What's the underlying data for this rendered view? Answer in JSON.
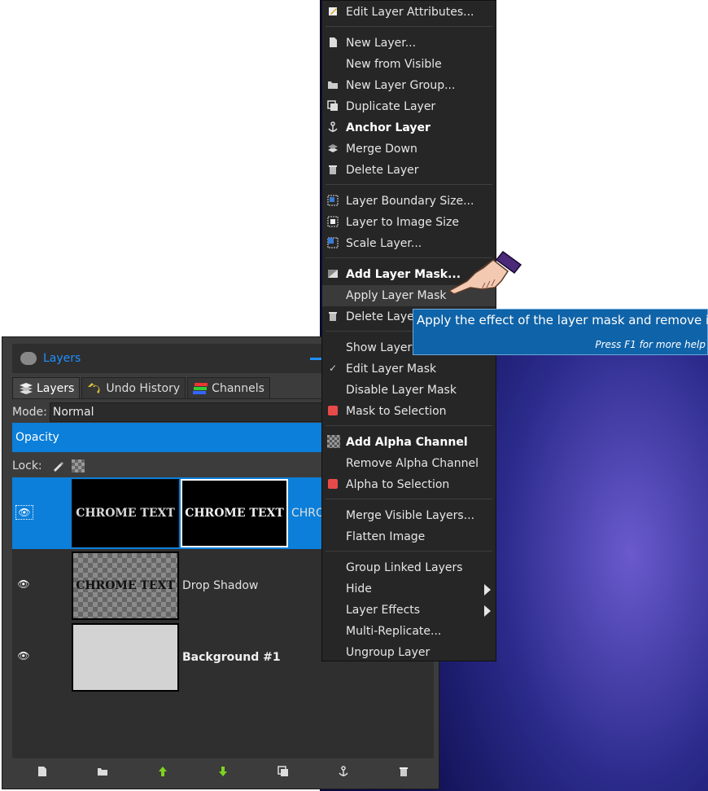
{
  "dock": {
    "title": "Layers",
    "tabs": [
      {
        "label": "Layers",
        "icon": "layers-icon"
      },
      {
        "label": "Undo History",
        "icon": "undo-history-icon"
      },
      {
        "label": "Channels",
        "icon": "channels-icon"
      }
    ],
    "mode_label": "Mode:",
    "mode_value": "Normal",
    "opacity_label": "Opacity",
    "lock_label": "Lock:",
    "layers": [
      {
        "thumb_text": "CHROME TEXT",
        "mask_text": "CHROME TEXT",
        "name": "CHRO",
        "selected": true
      },
      {
        "thumb_text": "CHROME TEXT",
        "name": "Drop Shadow"
      },
      {
        "name": "Background #1"
      }
    ]
  },
  "menu": {
    "items": [
      {
        "label": "Edit Layer Attributes...",
        "icon": "edit-icon"
      },
      {
        "label": "New Layer...",
        "icon": "new-layer-icon"
      },
      {
        "label": "New from Visible",
        "icon": ""
      },
      {
        "label": "New Layer Group...",
        "icon": "folder-icon"
      },
      {
        "label": "Duplicate Layer",
        "icon": "duplicate-icon"
      },
      {
        "label": "Anchor Layer",
        "icon": "anchor-icon",
        "bold": true
      },
      {
        "label": "Merge Down",
        "icon": "merge-down-icon"
      },
      {
        "label": "Delete Layer",
        "icon": "trash-icon"
      },
      {
        "label": "Layer Boundary Size...",
        "icon": "boundary-icon"
      },
      {
        "label": "Layer to Image Size",
        "icon": "to-image-icon"
      },
      {
        "label": "Scale Layer...",
        "icon": "scale-icon"
      },
      {
        "label": "Add Layer Mask...",
        "icon": "add-mask-icon",
        "bold": true
      },
      {
        "label": "Apply Layer Mask",
        "icon": "",
        "highlighted": true
      },
      {
        "label": "Delete Layer Mask",
        "icon": "trash-icon"
      },
      {
        "label": "Show Layer Mask",
        "icon": ""
      },
      {
        "label": "Edit Layer Mask",
        "icon": "check-icon"
      },
      {
        "label": "Disable Layer Mask",
        "icon": ""
      },
      {
        "label": "Mask to Selection",
        "icon": "red-square-icon"
      },
      {
        "label": "Add Alpha Channel",
        "icon": "checker-icon",
        "bold": true
      },
      {
        "label": "Remove Alpha Channel",
        "icon": ""
      },
      {
        "label": "Alpha to Selection",
        "icon": "red-square-icon"
      },
      {
        "label": "Merge Visible Layers...",
        "icon": ""
      },
      {
        "label": "Flatten Image",
        "icon": ""
      },
      {
        "label": "Group Linked Layers",
        "icon": ""
      },
      {
        "label": "Hide",
        "icon": "",
        "submenu": true
      },
      {
        "label": "Layer Effects",
        "icon": "",
        "submenu": true
      },
      {
        "label": "Multi-Replicate...",
        "icon": ""
      },
      {
        "label": "Ungroup Layer",
        "icon": ""
      }
    ]
  },
  "tooltip": {
    "text": "Apply the effect of the layer mask and remove it",
    "help": "Press F1 for more help"
  },
  "colors": {
    "accent": "#0b7fd9",
    "menu_bg": "#262626",
    "dock_bg": "#3c3c3c",
    "tooltip_bg": "#0f63a8"
  }
}
